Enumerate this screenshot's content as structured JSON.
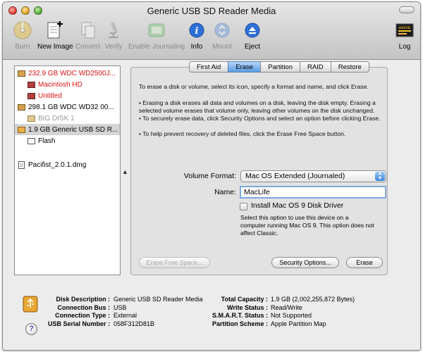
{
  "window": {
    "title": "Generic USB SD Reader Media"
  },
  "toolbar": {
    "burn": "Burn",
    "new_image": "New Image",
    "convert": "Convert",
    "verify": "Verify",
    "enable_journaling": "Enable Journaling",
    "info": "Info",
    "mount": "Mount",
    "eject": "Eject",
    "log": "Log",
    "log_icon_text": "WARNING"
  },
  "sidebar": {
    "items": [
      {
        "label": "232.9 GB WDC WD2500J..."
      },
      {
        "label": "Macintosh HD"
      },
      {
        "label": "Untitled"
      },
      {
        "label": "298.1 GB WDC WD32 00..."
      },
      {
        "label": "BIG DISK 1"
      },
      {
        "label": "1.9 GB Generic USB SD R..."
      },
      {
        "label": "Flash"
      },
      {
        "label": "Pacifist_2.0.1.dmg"
      }
    ]
  },
  "tabs": [
    "First Aid",
    "Erase",
    "Partition",
    "RAID",
    "Restore"
  ],
  "erase": {
    "intro": "To erase a disk or volume, select its icon, specify a format and name, and click Erase.",
    "bullet1": "• Erasing a disk erases all data and volumes on a disk, leaving the disk empty. Erasing a selected volume erases that volume only, leaving other volumes on the disk unchanged.",
    "bullet2": "• To securely erase data, click Security Options and select an option before clicking Erase.",
    "bullet3": "• To help prevent recovery of deleted files, click the Erase Free Space button.",
    "format_label": "Volume Format:",
    "format_value": "Mac OS Extended (Journaled)",
    "name_label": "Name:",
    "name_value": "MacLife",
    "os9_label": "Install Mac OS 9 Disk Driver",
    "os9_note": "Select this option to use this device on a computer running Mac OS 9. This option does not affect Classic.",
    "erase_free_space": "Erase Free Space...",
    "security_options": "Security Options...",
    "erase_button": "Erase"
  },
  "info": {
    "left_keys": [
      "Disk Description :",
      "Connection Bus :",
      "Connection Type :",
      "USB Serial Number :"
    ],
    "left_vals": [
      "Generic USB SD Reader Media",
      "USB",
      "External",
      "058F312D81B"
    ],
    "right_keys": [
      "Total Capacity :",
      "Write Status :",
      "S.M.A.R.T. Status :",
      "Partition Scheme :"
    ],
    "right_vals": [
      "1.9 GB (2,002,255,872 Bytes)",
      "Read/Write",
      "Not Supported",
      "Apple Partition Map"
    ]
  },
  "help": "?"
}
